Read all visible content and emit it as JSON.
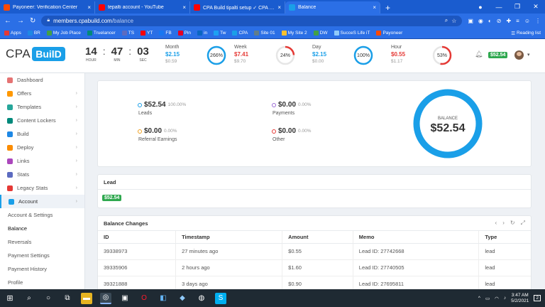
{
  "browser": {
    "tabs": [
      {
        "title": "Payoneer: Verification Center",
        "icon_color": "#ff4800",
        "active": false
      },
      {
        "title": "tepalti account - YouTube",
        "icon_color": "#ff0000",
        "active": false
      },
      {
        "title": "CPA Build tipalti setup ✓ CPA B...",
        "icon_color": "#ff0000",
        "active": false
      },
      {
        "title": "Balance",
        "icon_color": "#1a9fe8",
        "active": true
      }
    ],
    "new_tab": "+",
    "url_domain": "members.cpabuild.com",
    "url_path": "/balance",
    "bookmarks": [
      {
        "label": "Apps",
        "color": "#e53935"
      },
      {
        "label": "BR",
        "color": "#1e88e5"
      },
      {
        "label": "My Job Place",
        "color": "#43a047"
      },
      {
        "label": "Truelancer",
        "color": "#00897b"
      },
      {
        "label": "TS",
        "color": "#5c6bc0"
      },
      {
        "label": "YT",
        "color": "#ff0000"
      },
      {
        "label": "FB",
        "color": "#1877f2"
      },
      {
        "label": "Pin",
        "color": "#e60023"
      },
      {
        "label": "in",
        "color": "#0a66c2"
      },
      {
        "label": "Tw",
        "color": "#1da1f2"
      },
      {
        "label": "CPA",
        "color": "#1a9fe8"
      },
      {
        "label": "Site 01",
        "color": "#607d8b"
      },
      {
        "label": "My Site 2",
        "color": "#fbc02d"
      },
      {
        "label": "DW",
        "color": "#43a047"
      },
      {
        "label": "SucceS Life iT",
        "color": "#90caf9"
      },
      {
        "label": "Payoneer",
        "color": "#ff4800"
      }
    ],
    "reading_list": "Reading list"
  },
  "header": {
    "logo_cpa": "CPA",
    "logo_build": "BuilD",
    "timer": {
      "hours": "14",
      "hours_label": "HOUR",
      "minutes": "47",
      "minutes_label": "MIN",
      "seconds": "03",
      "seconds_label": "SEC"
    },
    "stats": [
      {
        "name": "Month",
        "current": "$2.15",
        "previous": "$0.59",
        "percent": "266%",
        "fill": 1.0,
        "color": "#1a9fe8"
      },
      {
        "name": "Week",
        "current": "$7.41",
        "previous": "$9.70",
        "percent": "24%",
        "fill": 0.24,
        "color": "#e53935"
      },
      {
        "name": "Day",
        "current": "$2.15",
        "previous": "$0.00",
        "percent": "100%",
        "fill": 1.0,
        "color": "#1a9fe8"
      },
      {
        "name": "Hour",
        "current": "$0.55",
        "previous": "$1.17",
        "percent": "53%",
        "fill": 0.53,
        "color": "#e53935"
      }
    ],
    "balance_badge": "$52.54"
  },
  "sidebar": {
    "items": [
      {
        "label": "Dashboard",
        "color": "#e57373",
        "arrow": ""
      },
      {
        "label": "Offers",
        "color": "#ff9800",
        "arrow": "›"
      },
      {
        "label": "Templates",
        "color": "#26a69a",
        "arrow": "›"
      },
      {
        "label": "Content Lockers",
        "color": "#00897b",
        "arrow": "›"
      },
      {
        "label": "Build",
        "color": "#1e88e5",
        "arrow": "›"
      },
      {
        "label": "Deploy",
        "color": "#fb8c00",
        "arrow": "›"
      },
      {
        "label": "Links",
        "color": "#ab47bc",
        "arrow": "›"
      },
      {
        "label": "Stats",
        "color": "#5c6bc0",
        "arrow": "›"
      },
      {
        "label": "Legacy Stats",
        "color": "#e53935",
        "arrow": "›"
      },
      {
        "label": "Account",
        "color": "#1a9fe8",
        "arrow": "›"
      }
    ],
    "sub_items": [
      "Account & Settings",
      "Balance",
      "Reversals",
      "Payment Settings",
      "Payment History",
      "Profile"
    ]
  },
  "balance_summary": {
    "items": [
      {
        "amount": "$52.54",
        "percent": "100.00%",
        "name": "Leads",
        "color": "#1a9fe8"
      },
      {
        "amount": "$0.00",
        "percent": "0.00%",
        "name": "Payments",
        "color": "#9c6ad6"
      },
      {
        "amount": "$0.00",
        "percent": "0.00%",
        "name": "Referral Earnings",
        "color": "#f0a020"
      },
      {
        "amount": "$0.00",
        "percent": "0.00%",
        "name": "Other",
        "color": "#e53935"
      }
    ],
    "ring_label": "BALANCE",
    "ring_value": "$52.54",
    "ring_color": "#1a9fe8"
  },
  "lead_card": {
    "title": "Lead",
    "badge": "$52.54"
  },
  "balance_changes": {
    "title": "Balance Changes",
    "columns": [
      "ID",
      "Timestamp",
      "Amount",
      "Memo",
      "Type"
    ],
    "rows": [
      {
        "id": "39338973",
        "timestamp": "27 minutes ago",
        "amount": "$0.55",
        "memo": "Lead ID: 27742668",
        "type": "lead"
      },
      {
        "id": "39335906",
        "timestamp": "2 hours ago",
        "amount": "$1.60",
        "memo": "Lead ID: 27740505",
        "type": "lead"
      },
      {
        "id": "39321888",
        "timestamp": "3 days ago",
        "amount": "$0.90",
        "memo": "Lead ID: 27695811",
        "type": "lead"
      }
    ]
  },
  "taskbar": {
    "time": "3:47 AM",
    "date": "5/2/2021",
    "notifications": "2"
  }
}
